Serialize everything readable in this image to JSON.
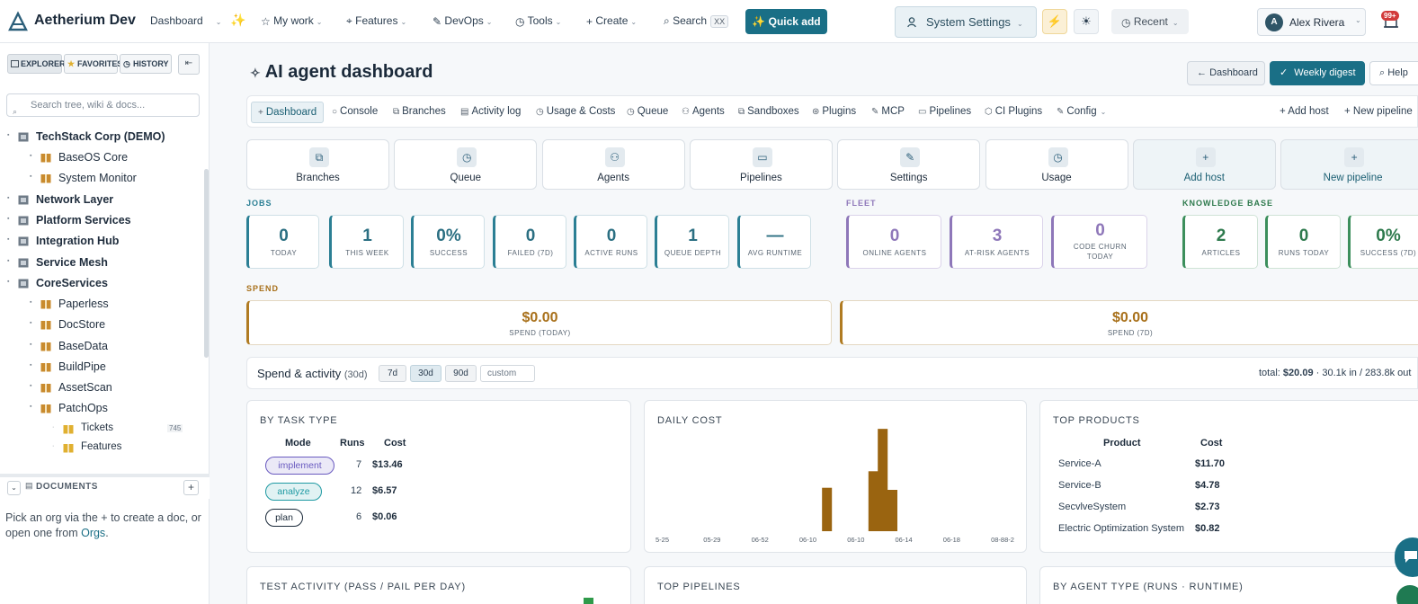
{
  "app": {
    "title": "Aetherium Dev"
  },
  "topnav": {
    "dashboard": "Dashboard",
    "my_work": "My work",
    "features": "Features",
    "devops": "DevOps",
    "tools": "Tools",
    "create": "Create",
    "search": "Search",
    "search_kbd": "XX",
    "quick_add": "✨ Quick add",
    "system_settings": "System Settings",
    "recent": "Recent",
    "user_name": "Alex Rivera",
    "user_initial": "A",
    "notif_count": "99+"
  },
  "sidebar": {
    "tabs": [
      "EXPLORER",
      "FAVORITES",
      "HISTORY"
    ],
    "search_placeholder": "Search tree, wiki & docs...",
    "tree": [
      {
        "label": "TechStack Corp (DEMO)",
        "level": 0
      },
      {
        "label": "BaseOS Core",
        "level": 1
      },
      {
        "label": "System Monitor",
        "level": 1
      },
      {
        "label": "Network Layer",
        "level": 0
      },
      {
        "label": "Platform Services",
        "level": 0
      },
      {
        "label": "Integration Hub",
        "level": 0
      },
      {
        "label": "Service Mesh",
        "level": 0
      },
      {
        "label": "CoreServices",
        "level": 0
      },
      {
        "label": "Paperless",
        "level": 1
      },
      {
        "label": "DocStore",
        "level": 1
      },
      {
        "label": "BaseData",
        "level": 1
      },
      {
        "label": "BuildPipe",
        "level": 1
      },
      {
        "label": "AssetScan",
        "level": 1
      },
      {
        "label": "PatchOps",
        "level": 1
      },
      {
        "label": "Tickets",
        "level": 2,
        "count": "745"
      },
      {
        "label": "Features",
        "level": 2
      }
    ],
    "documents_label": "DOCUMENTS",
    "docs_hint_prefix": "Pick an org via the + to create a doc, or open one from ",
    "docs_hint_link": "Orgs",
    "docs_hint_suffix": "."
  },
  "page": {
    "title": "AI agent dashboard",
    "actions": {
      "dashboard": "Dashboard",
      "weekly_digest": "Weekly digest",
      "help": "Help"
    }
  },
  "tabs": [
    "Dashboard",
    "Console",
    "Branches",
    "Activity log",
    "Usage & Costs",
    "Queue",
    "Agents",
    "Sandboxes",
    "Plugins",
    "MCP",
    "Pipelines",
    "CI Plugins",
    "Config"
  ],
  "tab_actions": {
    "add_host": "Add host",
    "new_pipeline": "New pipeline"
  },
  "quick_cards": [
    "Branches",
    "Queue",
    "Agents",
    "Pipelines",
    "Settings",
    "Usage",
    "Add host",
    "New pipeline"
  ],
  "sections": {
    "jobs": "JOBS",
    "fleet": "FLEET",
    "knowledge_base": "KNOWLEDGE BASE",
    "spend": "SPEND"
  },
  "jobs": [
    {
      "value": "0",
      "label": "TODAY"
    },
    {
      "value": "1",
      "label": "THIS WEEK"
    },
    {
      "value": "0%",
      "label": "SUCCESS"
    },
    {
      "value": "0",
      "label": "FAILED (7D)"
    },
    {
      "value": "0",
      "label": "ACTIVE RUNS"
    },
    {
      "value": "1",
      "label": "QUEUE DEPTH"
    },
    {
      "value": "—",
      "label": "AVG RUNTIME"
    }
  ],
  "fleet": [
    {
      "value": "0",
      "label": "ONLINE AGENTS"
    },
    {
      "value": "3",
      "label": "AT-RISK AGENTS"
    },
    {
      "value": "0",
      "label": "CODE CHURN TODAY"
    }
  ],
  "knowledge_base": [
    {
      "value": "2",
      "label": "ARTICLES"
    },
    {
      "value": "0",
      "label": "RUNS TODAY"
    },
    {
      "value": "0%",
      "label": "SUCCESS (7D)"
    }
  ],
  "spend": [
    {
      "value": "$0.00",
      "label": "SPEND (TODAY)"
    },
    {
      "value": "$0.00",
      "label": "SPEND (7D)"
    }
  ],
  "spend_activity": {
    "title": "Spend & activity",
    "period": "(30d)",
    "ranges": [
      "7d",
      "30d",
      "90d"
    ],
    "selected_range": "30d",
    "custom_placeholder": "custom",
    "total_label": "total:",
    "total_value": "$20.09",
    "total_rest": "· 30.1k in / 283.8k out"
  },
  "by_task_type": {
    "title": "BY TASK TYPE",
    "columns": [
      "Mode",
      "Runs",
      "Cost"
    ],
    "rows": [
      {
        "mode": "implement",
        "runs": "7",
        "cost": "$13.46",
        "color": "#6a5bc0"
      },
      {
        "mode": "analyze",
        "runs": "12",
        "cost": "$6.57",
        "color": "#1f9aa3"
      },
      {
        "mode": "plan",
        "runs": "6",
        "cost": "$0.06",
        "color": "#1b2a3a"
      }
    ]
  },
  "daily_cost": {
    "title": "DAILY COST",
    "chart_data": {
      "type": "bar",
      "x_ticks": [
        "5-25",
        "05-29",
        "06-52",
        "06-10",
        "06-10",
        "06-14",
        "06-18",
        "08-88-2"
      ],
      "bars": [
        {
          "slot": 0.463,
          "value": 4.2
        },
        {
          "slot": 0.592,
          "value": 5.8
        },
        {
          "slot": 0.618,
          "value": 9.9
        },
        {
          "slot": 0.645,
          "value": 4.0
        }
      ],
      "ylim": [
        0,
        10
      ],
      "color": "#9a6410"
    }
  },
  "top_products": {
    "title": "TOP PRODUCTS",
    "columns": [
      "Product",
      "Cost"
    ],
    "rows": [
      {
        "product": "Service-A",
        "cost": "$11.70"
      },
      {
        "product": "Service-B",
        "cost": "$4.78"
      },
      {
        "product": "SecvlveSystem",
        "cost": "$2.73"
      },
      {
        "product": "Electric Optimization System",
        "cost": "$0.82"
      }
    ]
  },
  "bottom_panels": [
    "TEST ACTIVITY (PASS / PAIL PER DAY)",
    "TOP PIPELINES",
    "BY AGENT TYPE (RUNS · RUNTIME)"
  ],
  "colors": {
    "accent": "#1a6f86",
    "spend": "#a8701a",
    "fleet": "#8e77b9",
    "kb": "#2e7a4d"
  }
}
